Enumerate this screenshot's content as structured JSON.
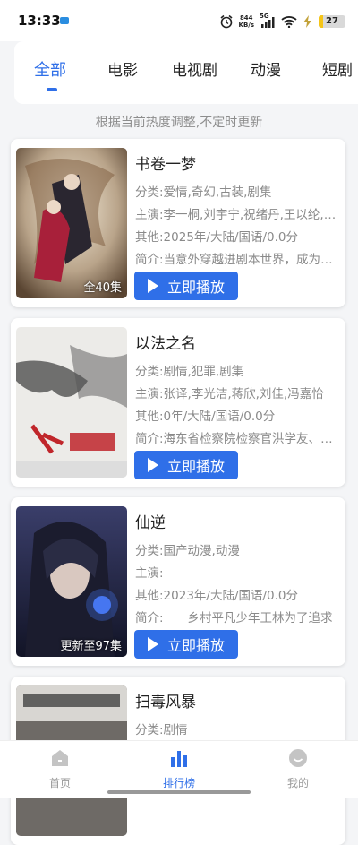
{
  "status_bar": {
    "time": "13:33",
    "network_speed_value": "844",
    "network_speed_unit": "KB/s",
    "signal_label": "5G",
    "battery": "27"
  },
  "tabs": [
    {
      "label": "全部",
      "active": true
    },
    {
      "label": "电影",
      "active": false
    },
    {
      "label": "电视剧",
      "active": false
    },
    {
      "label": "动漫",
      "active": false
    },
    {
      "label": "短剧",
      "active": false
    }
  ],
  "hint": "根据当前热度调整,不定时更新",
  "items": [
    {
      "title": "书卷一梦",
      "category": "分类:爱情,奇幻,古装,剧集",
      "cast": "主演:李一桐,刘宇宁,祝绪丹,王以纶,杨肸子",
      "other": "其他:2025年/大陆/国语/0.0分",
      "intro": "简介:当意外穿越进剧本世界，成为书中人物",
      "episodes": "全40集",
      "play_label": "立即播放"
    },
    {
      "title": "以法之名",
      "category": "分类:剧情,犯罪,剧集",
      "cast": "主演:张译,李光洁,蒋欣,刘佳,冯嘉怡",
      "other": "其他:0年/大陆/国语/0.0分",
      "intro": "简介:海东省检察院检察官洪学友、万海",
      "episodes": "",
      "play_label": "立即播放"
    },
    {
      "title": "仙逆",
      "category": "分类:国产动漫,动漫",
      "cast": "主演:",
      "other": "其他:2023年/大陆/国语/0.0分",
      "intro": "简介:　　乡村平凡少年王林为了追求",
      "episodes": "更新至97集",
      "play_label": "立即播放"
    },
    {
      "title": "扫毒风暴",
      "category": "分类:剧情",
      "cast": "",
      "other": "",
      "intro": "",
      "episodes": "",
      "play_label": ""
    }
  ],
  "bottom_nav": [
    {
      "label": "首页",
      "icon": "home-icon",
      "active": false
    },
    {
      "label": "排行榜",
      "icon": "ranking-icon",
      "active": true
    },
    {
      "label": "我的",
      "icon": "profile-icon",
      "active": false
    }
  ],
  "colors": {
    "accent": "#2f6fe8",
    "background": "#f4f5f7"
  }
}
